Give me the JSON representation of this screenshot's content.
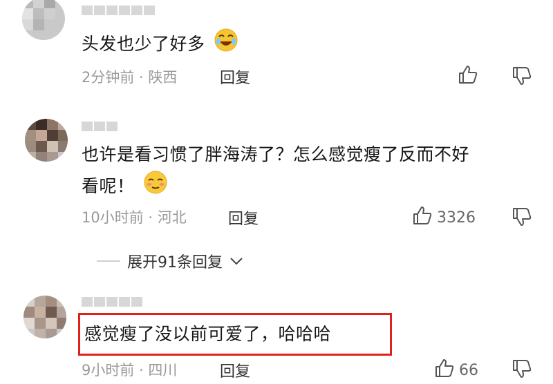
{
  "comments": [
    {
      "text": "头发也少了好多",
      "emoji": "laughing-crying-emoji",
      "time_location": "2分钟前 · 陕西",
      "reply_label": "回复",
      "likes": ""
    },
    {
      "text": "也许是看习惯了胖海涛了？怎么感觉瘦了反而不好",
      "text_line2": "看呢！",
      "emoji": "smirk-emoji",
      "time_location": "10小时前 · 河北",
      "reply_label": "回复",
      "likes": "3326"
    },
    {
      "text": "感觉瘦了没以前可爱了，哈哈哈",
      "time_location": "9小时前 · 四川",
      "reply_label": "回复",
      "likes": "66"
    }
  ],
  "expand_replies": {
    "label": "展开91条回复"
  },
  "colors": {
    "highlight": "#e0201b",
    "meta": "#9a9a9a"
  }
}
